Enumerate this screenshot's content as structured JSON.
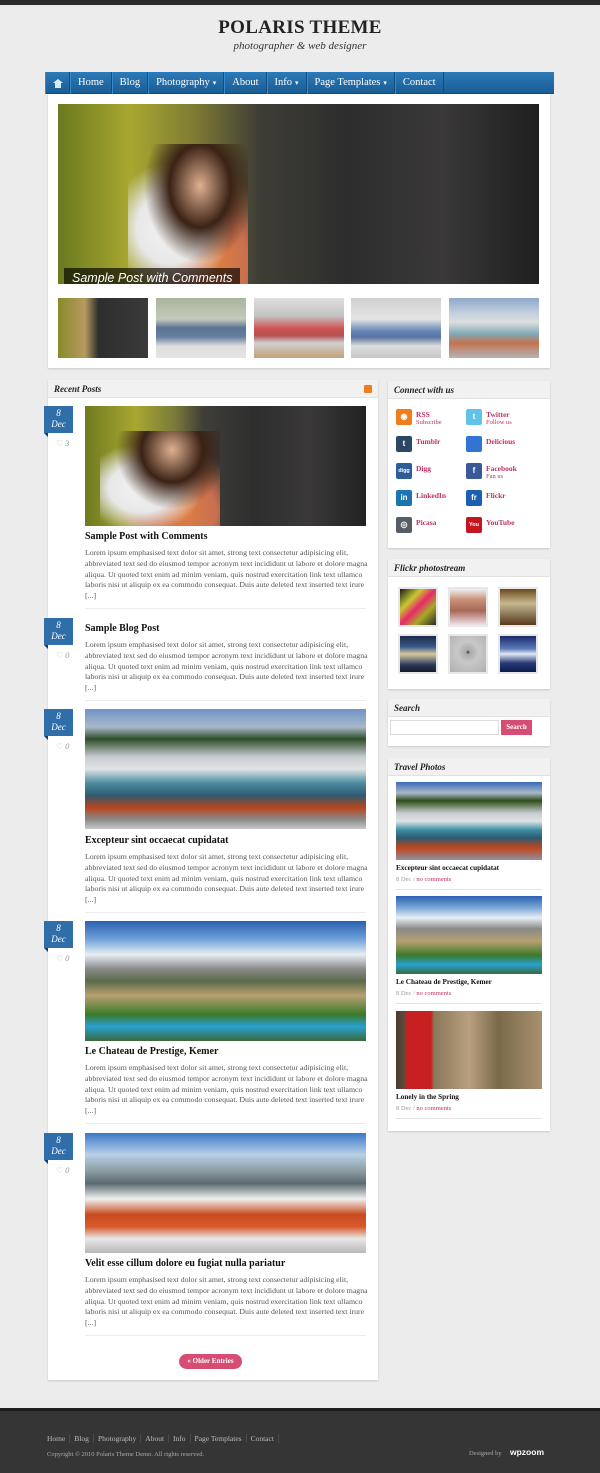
{
  "header": {
    "title": "POLARIS THEME",
    "tagline": "photographer & web designer"
  },
  "nav": {
    "home_icon": "home-icon",
    "items": [
      {
        "label": "Home",
        "dropdown": false
      },
      {
        "label": "Blog",
        "dropdown": false
      },
      {
        "label": "Photography",
        "dropdown": true
      },
      {
        "label": "About",
        "dropdown": false
      },
      {
        "label": "Info",
        "dropdown": true
      },
      {
        "label": "Page Templates",
        "dropdown": true
      },
      {
        "label": "Contact",
        "dropdown": false
      }
    ],
    "caret": "▾"
  },
  "slider": {
    "caption": "Sample Post with Comments",
    "thumbnails": [
      "woman-with-teddy-bear",
      "blue-bmw-coupe",
      "red-bmw-suv",
      "blue-bmw-roadster",
      "steaming-hot-spring"
    ]
  },
  "recent_posts": {
    "heading": "Recent Posts",
    "rss_icon": "rss-icon",
    "posts": [
      {
        "day": "8",
        "month": "Dec",
        "likes": "3",
        "title": "Sample Post with Comments",
        "has_image": true,
        "excerpt": "Lorem ipsum emphasised text dolor sit amet, strong text consectetur adipisicing elit, abbreviated text sed do eiusmod tempor acronym text incididunt ut labore et dolore magna aliqua. Ut quoted text enim ad minim veniam, quis nostrud exercitation link text ullamco laboris nisi ut aliquip ex ea commodo consequat. Duis aute deleted text inserted text irure [...]"
      },
      {
        "day": "8",
        "month": "Dec",
        "likes": "0",
        "title": "Sample Blog Post",
        "has_image": false,
        "excerpt": "Lorem ipsum emphasised text dolor sit amet, strong text consectetur adipisicing elit, abbreviated text sed do eiusmod tempor acronym text incididunt ut labore et dolore magna aliqua. Ut quoted text enim ad minim veniam, quis nostrud exercitation link text ullamco laboris nisi ut aliquip ex ea commodo consequat. Duis aute deleted text inserted text irure [...]"
      },
      {
        "day": "8",
        "month": "Dec",
        "likes": "0",
        "title": "Excepteur sint occaecat cupidatat",
        "has_image": true,
        "excerpt": "Lorem ipsum emphasised text dolor sit amet, strong text consectetur adipisicing elit, abbreviated text sed do eiusmod tempor acronym text incididunt ut labore et dolore magna aliqua. Ut quoted text enim ad minim veniam, quis nostrud exercitation link text ullamco laboris nisi ut aliquip ex ea commodo consequat. Duis aute deleted text inserted text irure [...]"
      },
      {
        "day": "8",
        "month": "Dec",
        "likes": "0",
        "title": "Le Chateau de Prestige, Kemer",
        "has_image": true,
        "excerpt": "Lorem ipsum emphasised text dolor sit amet, strong text consectetur adipisicing elit, abbreviated text sed do eiusmod tempor acronym text incididunt ut labore et dolore magna aliqua. Ut quoted text enim ad minim veniam, quis nostrud exercitation link text ullamco laboris nisi ut aliquip ex ea commodo consequat. Duis aute deleted text inserted text irure [...]"
      },
      {
        "day": "8",
        "month": "Dec",
        "likes": "0",
        "title": "Velit esse cillum dolore eu fugiat nulla pariatur",
        "has_image": true,
        "excerpt": "Lorem ipsum emphasised text dolor sit amet, strong text consectetur adipisicing elit, abbreviated text sed do eiusmod tempor acronym text incididunt ut labore et dolore magna aliqua. Ut quoted text enim ad minim veniam, quis nostrud exercitation link text ullamco laboris nisi ut aliquip ex ea commodo consequat. Duis aute deleted text inserted text irure [...]"
      }
    ],
    "older_entries_label": "« Older Entries"
  },
  "sidebar": {
    "connect": {
      "heading": "Connect with us",
      "items": [
        {
          "name": "RSS",
          "sub": "Subscribe",
          "icon": "rss-icon",
          "glyph": "◉",
          "color": "#f07d1b"
        },
        {
          "name": "Twitter",
          "sub": "Follow us",
          "icon": "twitter-icon",
          "glyph": "t",
          "color": "#5fc3ea"
        },
        {
          "name": "Tumblr",
          "sub": "",
          "icon": "tumblr-icon",
          "glyph": "t",
          "color": "#2c4762"
        },
        {
          "name": "Delicious",
          "sub": "",
          "icon": "delicious-icon",
          "glyph": "",
          "color": "#3274d1"
        },
        {
          "name": "Digg",
          "sub": "",
          "icon": "digg-icon",
          "glyph": "digg",
          "color": "#2d5e9a"
        },
        {
          "name": "Facebook",
          "sub": "Fan us",
          "icon": "facebook-icon",
          "glyph": "f",
          "color": "#3b5998"
        },
        {
          "name": "LinkedIn",
          "sub": "",
          "icon": "linkedin-icon",
          "glyph": "in",
          "color": "#1c75b0"
        },
        {
          "name": "Flickr",
          "sub": "",
          "icon": "flickr-icon",
          "glyph": "fr",
          "color": "#1a5fb0"
        },
        {
          "name": "Picasa",
          "sub": "",
          "icon": "picasa-icon",
          "glyph": "◎",
          "color": "#555e66"
        },
        {
          "name": "YouTube",
          "sub": "",
          "icon": "youtube-icon",
          "glyph": "You",
          "color": "#c4161c"
        }
      ]
    },
    "flickr": {
      "heading": "Flickr photostream",
      "photos": [
        "pink-yellow-abstract",
        "two-children-portrait",
        "vintage-framed-photo",
        "sunset-clouds",
        "paraglider-grey-sky",
        "blue-clouds-night"
      ]
    },
    "search": {
      "heading": "Search",
      "input_value": "",
      "placeholder": "",
      "button_label": "Search"
    },
    "travel": {
      "heading": "Travel Photos",
      "items": [
        {
          "title": "Excepteur sint occaecat cupidatat",
          "date": "8 Dec",
          "sep": " / ",
          "comments": "no comments"
        },
        {
          "title": "Le Chateau de Prestige, Kemer",
          "date": "8 Dec",
          "sep": " / ",
          "comments": "no comments"
        },
        {
          "title": "Lonely in the Spring",
          "date": "8 Dec",
          "sep": " / ",
          "comments": "no comments"
        }
      ]
    }
  },
  "footer": {
    "nav": [
      "Home",
      "Blog",
      "Photography",
      "About",
      "Info",
      "Page Templates",
      "Contact"
    ],
    "copyright": "Copyright © 2010 Polaris Theme Demo. All rights reserved.",
    "designed_by": "Designed by",
    "designer": "wpzoom"
  },
  "colors": {
    "nav_blue": "#1f6aa8",
    "date_badge": "#2f6ea8",
    "accent_pink": "#d64c72",
    "link_pink": "#c2305e",
    "footer_bg": "#353535"
  }
}
